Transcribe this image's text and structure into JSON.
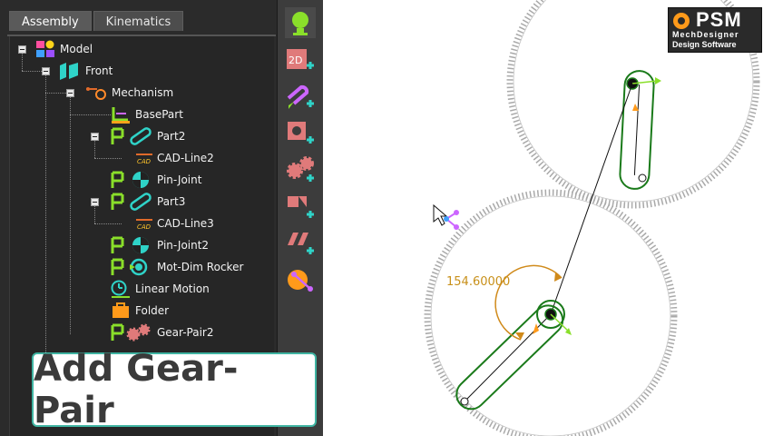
{
  "tabs": [
    {
      "label": "Assembly",
      "active": true
    },
    {
      "label": "Kinematics",
      "active": false
    }
  ],
  "tree": {
    "model": "Model",
    "front": "Front",
    "mechanism": "Mechanism",
    "basepart": "BasePart",
    "part2": "Part2",
    "cad_line2": "CAD-Line2",
    "pin_joint": "Pin-Joint",
    "part3": "Part3",
    "cad_line3": "CAD-Line3",
    "pin_joint2": "Pin-Joint2",
    "motdim_rocker": "Mot-Dim Rocker",
    "linear_motion": "Linear Motion",
    "folder": "Folder",
    "gear_pair2": "Gear-Pair2"
  },
  "toolbar": {
    "icons": [
      "add-model-element-icon",
      "add-2d-sketch-icon",
      "add-part-icon",
      "add-joint-icon",
      "add-gear-pair-icon",
      "add-motion-dimension-icon",
      "add-function-icon",
      "add-kinematic-chain-icon"
    ]
  },
  "caption": {
    "text": "Add Gear-Pair"
  },
  "canvas": {
    "angle_value": "154.60000",
    "colors": {
      "gear": "#a9a9a9",
      "link": "#1a7a1a",
      "dimension": "#d08a1a",
      "rocker": "#111111"
    }
  },
  "logo": {
    "title": "PSM",
    "line1": "MechDesigner",
    "line2": "Design Software"
  },
  "cad_badge": "CAD"
}
